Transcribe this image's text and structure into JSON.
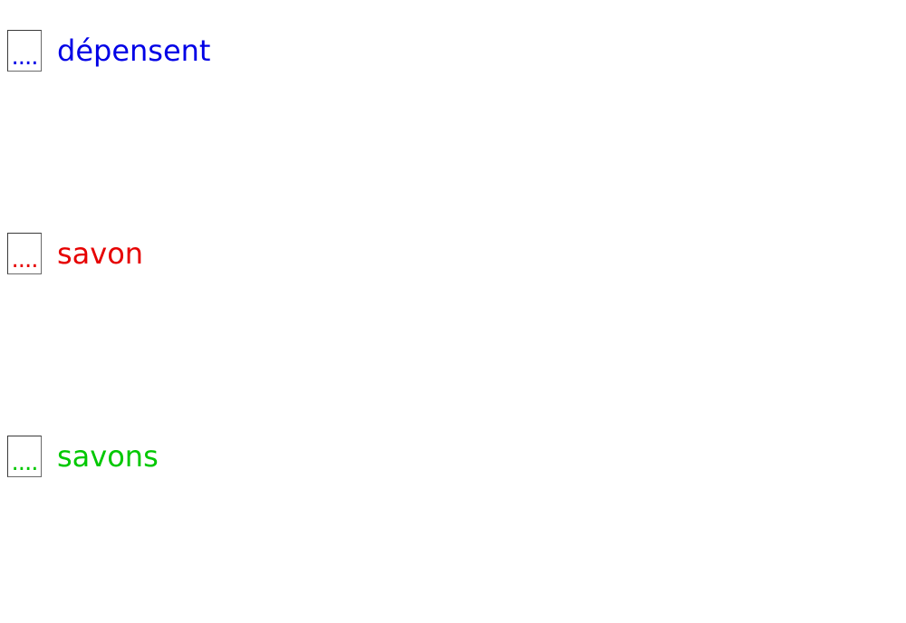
{
  "options": [
    {
      "placeholder": "....",
      "word": "dépensent",
      "color": "#0000e6"
    },
    {
      "placeholder": "....",
      "word": "savon",
      "color": "#e60000"
    },
    {
      "placeholder": "....",
      "word": "savons",
      "color": "#00c800"
    }
  ]
}
